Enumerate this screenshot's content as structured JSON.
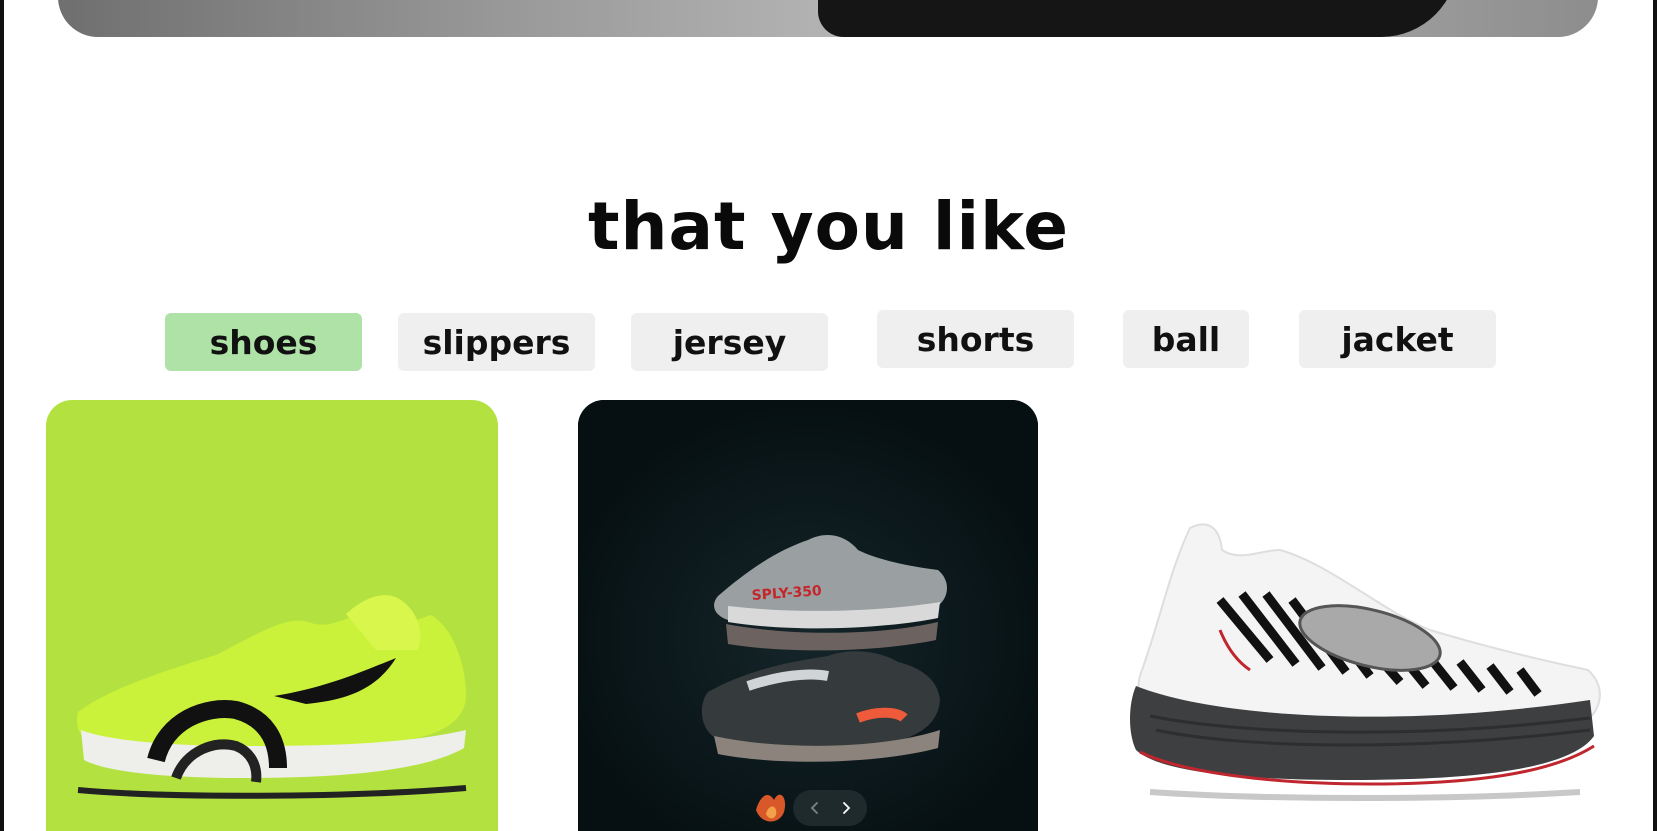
{
  "section": {
    "title": "that you like"
  },
  "tabs": [
    {
      "label": "shoes",
      "active": true
    },
    {
      "label": "slippers",
      "active": false
    },
    {
      "label": "jersey",
      "active": false
    },
    {
      "label": "shorts",
      "active": false
    },
    {
      "label": "ball",
      "active": false
    },
    {
      "label": "jacket",
      "active": false
    }
  ],
  "products": [
    {
      "image": "lime-green-running-shoe",
      "background": "#b3e240"
    },
    {
      "image": "two-sneakers-stacked-dark",
      "background": "#0b1517"
    },
    {
      "image": "white-knit-running-shoe",
      "background": "#ffffff"
    }
  ],
  "colors": {
    "active_tab": "#aee2a7",
    "tab": "#efefef",
    "text": "#0a0a0a"
  },
  "carousel": {
    "prev_icon": "chevron-left-icon",
    "next_icon": "chevron-right-icon"
  }
}
